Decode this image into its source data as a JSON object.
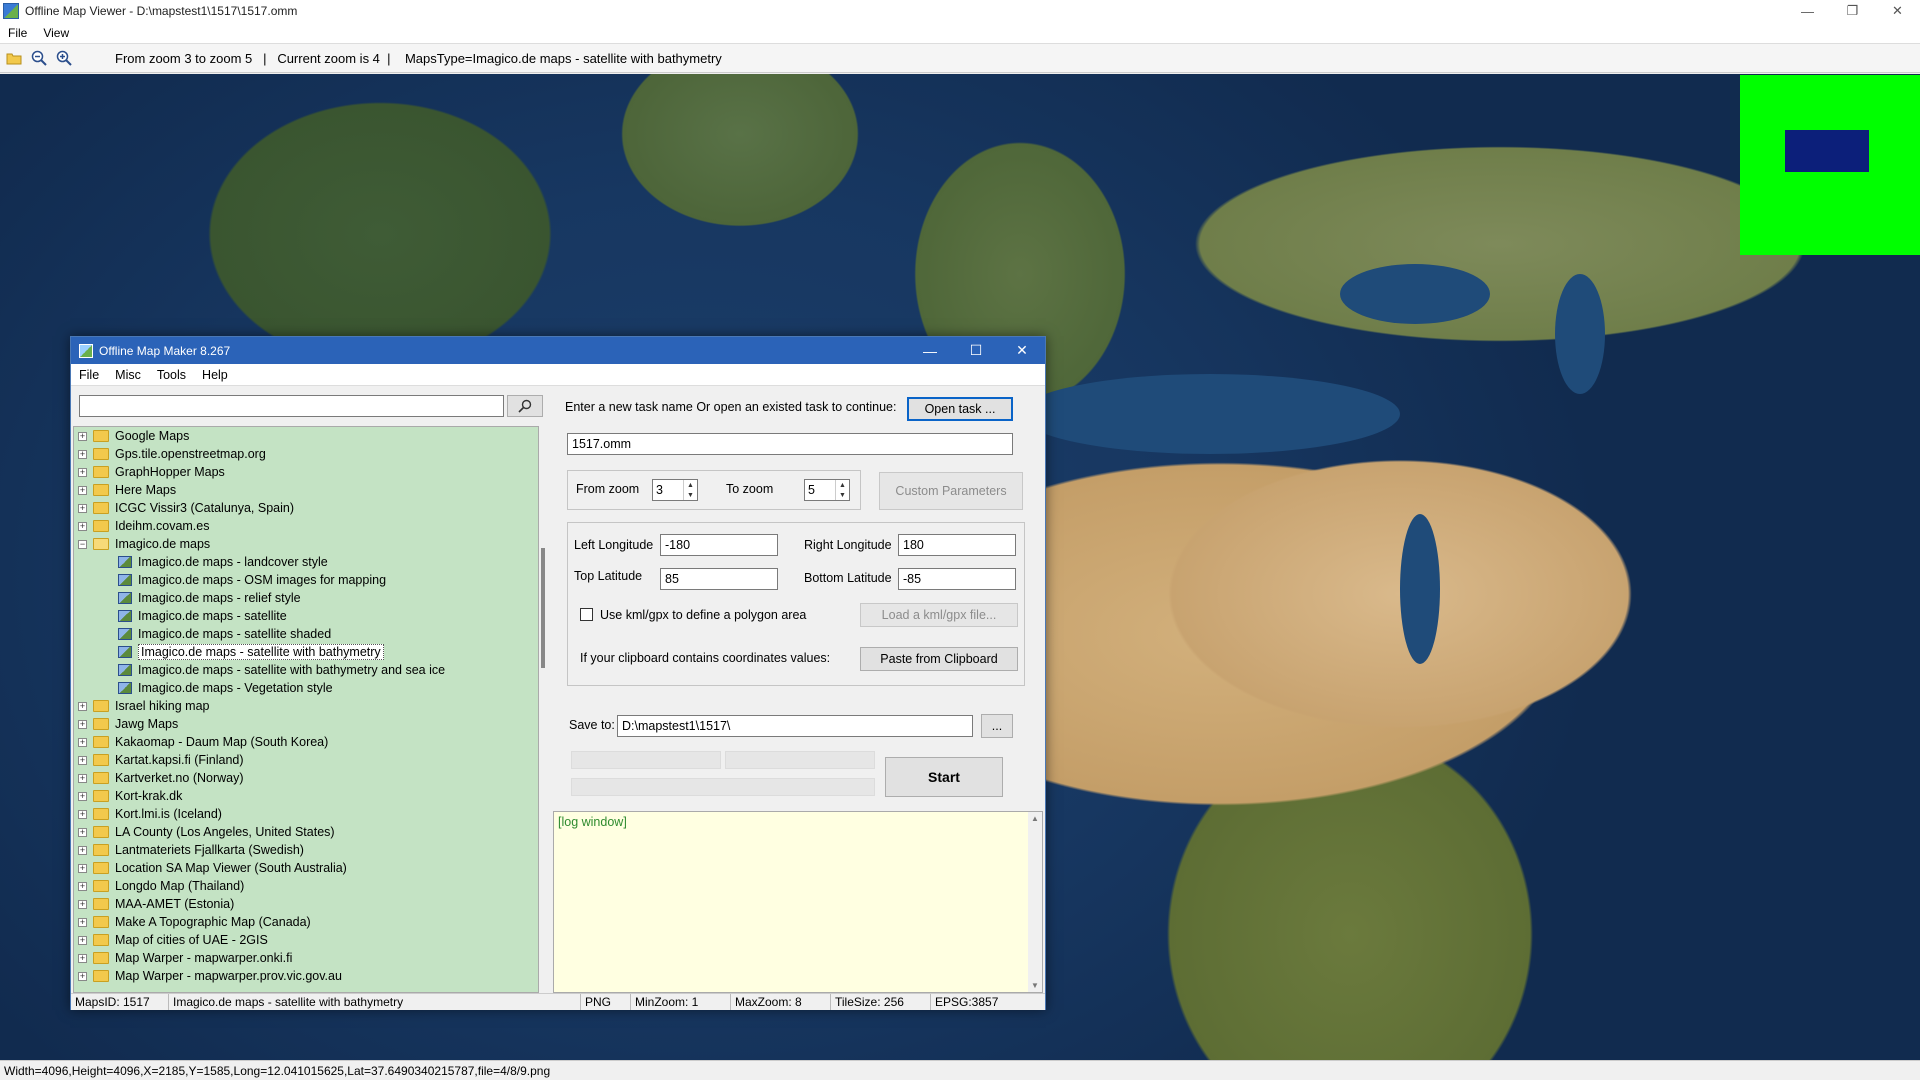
{
  "window": {
    "title": "Offline Map Viewer - D:\\mapstest1\\1517\\1517.omm",
    "controls": [
      "—",
      "❐",
      "✕"
    ]
  },
  "menu": [
    "File",
    "View"
  ],
  "toolbar": {
    "info": "From zoom 3 to zoom 5   |   Current zoom is 4  |    MapsType=Imagico.de maps - satellite with bathymetry"
  },
  "colors": {
    "overview_bg": "#00ff00",
    "overview_viewport": "#0c1f7a",
    "dialog_title": "#2b63b8",
    "tree_bg": "#c4e3c4",
    "log_bg": "#ffffe1"
  },
  "statusbar": {
    "text": "Width=4096,Height=4096,X=2185,Y=1585,Long=12.041015625,Lat=37.6490340215787,file=4/8/9.png"
  },
  "dialog": {
    "title": "Offline Map Maker 8.267",
    "controls": [
      "—",
      "☐",
      "✕"
    ],
    "menu": [
      "File",
      "Misc",
      "Tools",
      "Help"
    ],
    "search": {
      "value": "",
      "placeholder": ""
    },
    "tree": [
      {
        "label": "Google Maps",
        "type": "folder",
        "expanded": false
      },
      {
        "label": "Gps.tile.openstreetmap.org",
        "type": "folder",
        "expanded": false
      },
      {
        "label": "GraphHopper Maps",
        "type": "folder",
        "expanded": false
      },
      {
        "label": "Here Maps",
        "type": "folder",
        "expanded": false
      },
      {
        "label": "ICGC Vissir3 (Catalunya, Spain)",
        "type": "folder",
        "expanded": false
      },
      {
        "label": "Ideihm.covam.es",
        "type": "folder",
        "expanded": false
      },
      {
        "label": "Imagico.de maps",
        "type": "folder",
        "expanded": true
      },
      {
        "label": "Imagico.de maps - landcover style",
        "type": "map"
      },
      {
        "label": "Imagico.de maps - OSM images for mapping",
        "type": "map"
      },
      {
        "label": "Imagico.de maps - relief style",
        "type": "map"
      },
      {
        "label": "Imagico.de maps - satellite",
        "type": "map"
      },
      {
        "label": "Imagico.de maps - satellite shaded",
        "type": "map"
      },
      {
        "label": "Imagico.de maps - satellite with bathymetry",
        "type": "map",
        "selected": true
      },
      {
        "label": "Imagico.de maps - satellite with bathymetry and sea ice",
        "type": "map"
      },
      {
        "label": "Imagico.de maps - Vegetation style",
        "type": "map"
      },
      {
        "label": "Israel hiking map",
        "type": "folder",
        "expanded": false
      },
      {
        "label": "Jawg Maps",
        "type": "folder",
        "expanded": false
      },
      {
        "label": "Kakaomap - Daum Map (South Korea)",
        "type": "folder",
        "expanded": false
      },
      {
        "label": "Kartat.kapsi.fi (Finland)",
        "type": "folder",
        "expanded": false
      },
      {
        "label": "Kartverket.no (Norway)",
        "type": "folder",
        "expanded": false
      },
      {
        "label": "Kort-krak.dk",
        "type": "folder",
        "expanded": false
      },
      {
        "label": "Kort.lmi.is (Iceland)",
        "type": "folder",
        "expanded": false
      },
      {
        "label": "LA County (Los Angeles, United States)",
        "type": "folder",
        "expanded": false
      },
      {
        "label": "Lantmateriets Fjallkarta (Swedish)",
        "type": "folder",
        "expanded": false
      },
      {
        "label": "Location SA Map Viewer (South Australia)",
        "type": "folder",
        "expanded": false
      },
      {
        "label": "Longdo Map (Thailand)",
        "type": "folder",
        "expanded": false
      },
      {
        "label": "MAA-AMET (Estonia)",
        "type": "folder",
        "expanded": false
      },
      {
        "label": "Make A Topographic Map (Canada)",
        "type": "folder",
        "expanded": false
      },
      {
        "label": "Map of cities of UAE - 2GIS",
        "type": "folder",
        "expanded": false
      },
      {
        "label": "Map Warper - mapwarper.onki.fi",
        "type": "folder",
        "expanded": false
      },
      {
        "label": "Map Warper - mapwarper.prov.vic.gov.au",
        "type": "folder",
        "expanded": false
      }
    ],
    "task": {
      "prompt": "Enter a new task name Or open an existed task to continue:",
      "open_button": "Open task ...",
      "name_value": "1517.omm"
    },
    "zoom": {
      "from_label": "From zoom",
      "from_value": "3",
      "to_label": "To zoom",
      "to_value": "5",
      "custom_button": "Custom Parameters"
    },
    "bounds": {
      "left_lon_label": "Left Longitude",
      "left_lon_value": "-180",
      "right_lon_label": "Right Longitude",
      "right_lon_value": "180",
      "top_lat_label": "Top Latitude",
      "top_lat_value": "85",
      "bottom_lat_label": "Bottom Latitude",
      "bottom_lat_value": "-85",
      "kml_checkbox_label": "Use kml/gpx to define a polygon area",
      "kml_button": "Load a kml/gpx file...",
      "clipboard_label": "If your clipboard contains coordinates values:",
      "clipboard_button": "Paste from Clipboard"
    },
    "save": {
      "label": "Save to:",
      "value": "D:\\mapstest1\\1517\\",
      "browse_button": "...",
      "start_button": "Start"
    },
    "log": {
      "text": "[log window]"
    },
    "status": {
      "maps_id": "MapsID: 1517",
      "maps_name": "Imagico.de maps - satellite with bathymetry",
      "format": "PNG",
      "min_zoom": "MinZoom: 1",
      "max_zoom": "MaxZoom: 8",
      "tile_size": "TileSize: 256",
      "epsg": "EPSG:3857"
    }
  }
}
